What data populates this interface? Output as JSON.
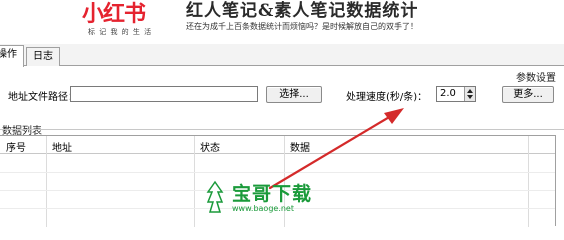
{
  "banner": {
    "logo_text": "小红书",
    "logo_slogan": "标 记 我 的 生 活",
    "title": "红人笔记&素人笔记数据统计",
    "subtitle": "还在为成千上百条数据统计而烦恼吗？是时候解放自己的双手了！"
  },
  "tabs": [
    {
      "label": "操作",
      "active": true
    },
    {
      "label": "日志",
      "active": false
    }
  ],
  "params": {
    "section_title": "参数设置",
    "path_label": "地址文件路径：",
    "path_value": "",
    "choose_button": "选择...",
    "speed_label": "处理速度(秒/条)：",
    "speed_value": "2.0",
    "more_button": "更多..."
  },
  "list": {
    "title": "数据列表",
    "columns": [
      "序号",
      "地址",
      "状态",
      "数据"
    ],
    "rows": []
  },
  "watermark": {
    "text": "宝哥下载",
    "url": "www.baoge.net"
  },
  "colors": {
    "logo_red": "#e5232f",
    "arrow_red": "#d42a2a",
    "watermark_green": "#1a9a3a"
  }
}
